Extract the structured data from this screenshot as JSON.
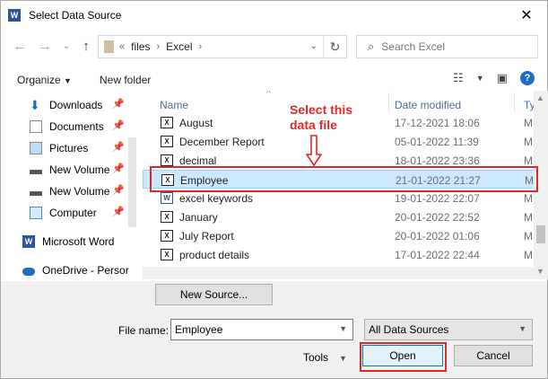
{
  "window": {
    "title": "Select Data Source",
    "app_icon": "W"
  },
  "nav": {
    "address_overflow": "«",
    "path": [
      "files",
      "Excel"
    ],
    "search_placeholder": "Search Excel"
  },
  "toolbar": {
    "organize_label": "Organize",
    "new_folder_label": "New folder",
    "help_label": "?"
  },
  "sidebar": {
    "items": [
      {
        "label": "Downloads",
        "icon": "download-icon",
        "pinned": true
      },
      {
        "label": "Documents",
        "icon": "documents-icon",
        "pinned": true
      },
      {
        "label": "Pictures",
        "icon": "pictures-icon",
        "pinned": true
      },
      {
        "label": "New Volume",
        "icon": "drive-icon",
        "pinned": true
      },
      {
        "label": "New Volume",
        "icon": "drive-icon",
        "pinned": true
      },
      {
        "label": "Computer",
        "icon": "computer-icon",
        "pinned": true
      },
      {
        "label": "Microsoft Word",
        "icon": "word-icon",
        "pinned": false
      },
      {
        "label": "OneDrive - Persor",
        "icon": "cloud-icon",
        "pinned": false
      }
    ]
  },
  "filelist": {
    "headers": {
      "name": "Name",
      "date": "Date modified",
      "type": "Ty"
    },
    "files": [
      {
        "name": "August",
        "date": "17-12-2021 18:06",
        "type": "M",
        "icon": "excel-file-icon",
        "selected": false
      },
      {
        "name": "December Report",
        "date": "05-01-2022 11:39",
        "type": "M",
        "icon": "excel-file-icon",
        "selected": false
      },
      {
        "name": "decimal",
        "date": "18-01-2022 23:36",
        "type": "M",
        "icon": "excel-file-icon",
        "selected": false
      },
      {
        "name": "Employee",
        "date": "21-01-2022 21:27",
        "type": "M",
        "icon": "excel-file-icon",
        "selected": true
      },
      {
        "name": "excel keywords",
        "date": "19-01-2022 22:07",
        "type": "M",
        "icon": "word-file-icon",
        "selected": false
      },
      {
        "name": "January",
        "date": "20-01-2022 22:52",
        "type": "M",
        "icon": "excel-file-icon",
        "selected": false
      },
      {
        "name": "July Report",
        "date": "20-01-2022 01:06",
        "type": "M",
        "icon": "excel-file-icon",
        "selected": false
      },
      {
        "name": "product details",
        "date": "17-01-2022 22:44",
        "type": "M",
        "icon": "excel-file-icon",
        "selected": false
      }
    ]
  },
  "footer": {
    "new_source_label": "New Source...",
    "file_name_label": "File name:",
    "file_name_value": "Employee",
    "filter_value": "All Data Sources",
    "tools_label": "Tools",
    "open_label": "Open",
    "cancel_label": "Cancel"
  },
  "annotation": {
    "line1": "Select this",
    "line2": "data file"
  },
  "colors": {
    "annotation_red": "#e12828",
    "selection_blue": "#cce8ff",
    "accent_blue": "#0078d7"
  }
}
